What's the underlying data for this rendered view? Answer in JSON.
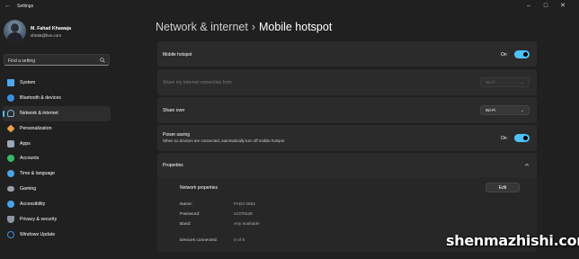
{
  "window": {
    "title": "Settings",
    "controls": [
      "minimize",
      "maximize",
      "close"
    ]
  },
  "profile": {
    "name": "M. Fahad Khawaja",
    "email": "sfm65@live.com"
  },
  "search": {
    "placeholder": "Find a setting"
  },
  "sidebar": {
    "items": [
      {
        "label": "System",
        "icon": "system-icon",
        "color": "#4fa6f0"
      },
      {
        "label": "Bluetooth & devices",
        "icon": "bluetooth-icon",
        "color": "#3b8fe0"
      },
      {
        "label": "Network & internet",
        "icon": "network-icon",
        "color": "#7fb3e8",
        "selected": true
      },
      {
        "label": "Personalization",
        "icon": "brush-icon",
        "color": "#e8a04a"
      },
      {
        "label": "Apps",
        "icon": "apps-icon",
        "color": "#9aa7b8"
      },
      {
        "label": "Accounts",
        "icon": "accounts-icon",
        "color": "#38b76a"
      },
      {
        "label": "Time & language",
        "icon": "clock-globe-icon",
        "color": "#4aa3e8"
      },
      {
        "label": "Gaming",
        "icon": "gaming-icon",
        "color": "#9aa0a8"
      },
      {
        "label": "Accessibility",
        "icon": "accessibility-icon",
        "color": "#4aa3e8"
      },
      {
        "label": "Privacy & security",
        "icon": "shield-icon",
        "color": "#8d96a3"
      },
      {
        "label": "Windows Update",
        "icon": "windows-update-icon",
        "color": "#3b8fe0"
      }
    ]
  },
  "main": {
    "breadcrumb_parent": "Network & internet",
    "breadcrumb_separator": "›",
    "page_title": "Mobile hotspot",
    "mobile_hotspot": {
      "label": "Mobile hotspot",
      "state": "On"
    },
    "share_from": {
      "label": "Share my Internet connection from",
      "value": "Wi-Fi"
    },
    "share_over": {
      "label": "Share over",
      "value": "Wi-Fi"
    },
    "power_saving": {
      "label": "Power saving",
      "description": "When no devices are connected, automatically turn off mobile hotspot",
      "state": "On"
    },
    "properties": {
      "label": "Properties",
      "network_heading": "Network properties",
      "edit_label": "Edit",
      "rows": [
        {
          "key": "Name:",
          "value": "FADII 0662"
        },
        {
          "key": "Password:",
          "value": "v237k538"
        },
        {
          "key": "Band:",
          "value": "Any available"
        },
        {
          "key": "Devices connected:",
          "value": "0 of 8"
        }
      ]
    }
  },
  "accent_color": "#4cc2ff",
  "watermark": "shenmazhishi.com"
}
